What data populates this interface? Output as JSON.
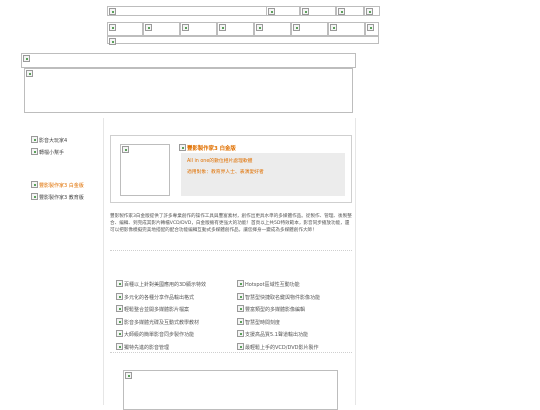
{
  "nav": [
    {
      "label": "影音大玩家4",
      "active": false
    },
    {
      "label": "轉檔小幫手",
      "active": false
    },
    {
      "label": "豐影製作家3 白金版",
      "active": true
    },
    {
      "label": "豐影製作家3 教育版",
      "active": false
    }
  ],
  "product": {
    "title": "豐影製作家3 白金版",
    "bullets": [
      "All in one的數位相片處理軟體",
      "適用對象：教育界人士、表演愛好者"
    ],
    "description": "豐影製作家3白金版提供了許多專業創作的操作工具與豐富素材，創作出更具水準的多媒體作品。從製作、管理、後製整合、編輯、到完成其影片轉檔VCD/DVD，白金版擁有更強大的功能！首頁以上共5D特效範本，影音同步播放功能，還可以把影像模擬完美地搭配的配合功能編輯互動式多媒體創作品，讓您揮身一變成為多媒體創作大師！"
  },
  "features_left": [
    "百種以上針對美國應用的3D顯示特效",
    "多元化的各種分享作品輸出格式",
    "輕鬆整合並開多媒體影片檔案",
    "影音多媒體光碟及互動式教學教材",
    "大師級的簡單影音同步製作功能",
    "獨特先進的影音管理"
  ],
  "features_right": [
    "Hotspot區域性互動功能",
    "智慧型快捷取名鍵與物件影像功能",
    "豐富類型的多媒體影像編輯",
    "智慧型時間刻度",
    "支援高品質5.1聲道輸出功能",
    "最輕鬆上手的VCD/DVD影片製作"
  ],
  "colors": {
    "accent_orange": "#e07000",
    "panel_gray": "#ececec",
    "border_gray": "#bdbdbd"
  }
}
